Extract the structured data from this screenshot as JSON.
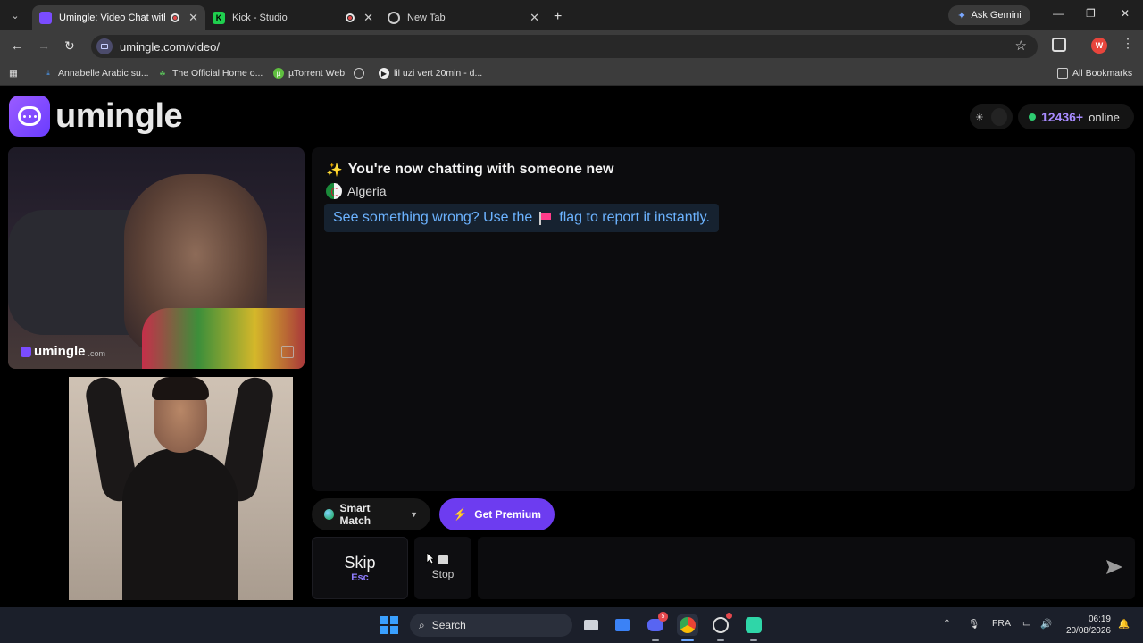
{
  "browser": {
    "tabs": [
      {
        "title": "Umingle: Video Chat with St",
        "active": true
      },
      {
        "title": "Kick - Studio",
        "active": false
      },
      {
        "title": "New Tab",
        "active": false
      }
    ],
    "gemini_label": "Ask Gemini",
    "url": "umingle.com/video/",
    "profile_initial": "W",
    "bookmarks": [
      "Annabelle Arabic su...",
      "The Official Home o...",
      "µTorrent Web",
      "",
      "lil uzi vert 20min - d..."
    ],
    "all_bookmarks": "All Bookmarks"
  },
  "app": {
    "brand": "umingle",
    "online_count": "12436+",
    "online_label": "online",
    "watermark": "umingle",
    "watermark_suffix": ".com",
    "chat": {
      "system_message": "You're now chatting with someone new",
      "country": "Algeria",
      "report_prefix": "See something wrong? Use the",
      "report_suffix": "flag to report it instantly."
    },
    "controls": {
      "smart_match": "Smart Match",
      "premium": "Get Premium",
      "skip": "Skip",
      "skip_hotkey": "Esc",
      "stop": "Stop",
      "message_placeholder": ""
    }
  },
  "taskbar": {
    "search_label": "Search",
    "language": "FRA",
    "time": "06:19",
    "date": "20/08/2026",
    "discord_badge": "5"
  },
  "colors": {
    "accent": "#6d3cf0",
    "online_dot": "#2ecc71",
    "report_text": "#6cb3ff",
    "flag": "#ff3c8a"
  }
}
